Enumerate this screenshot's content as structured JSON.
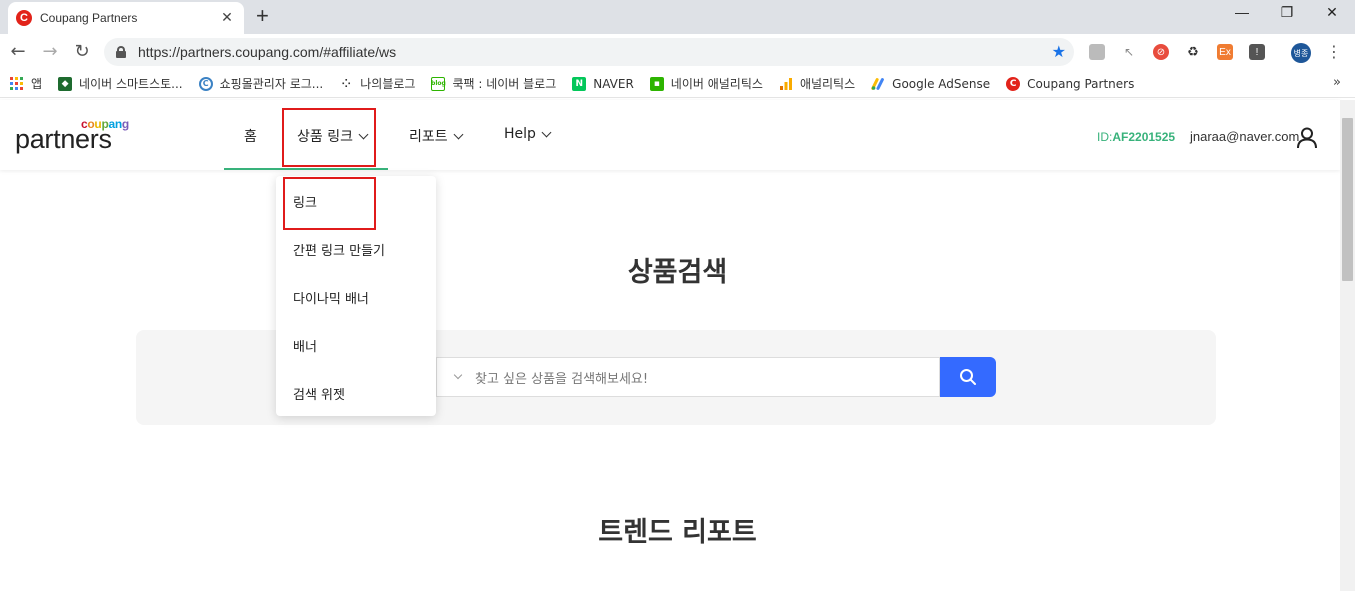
{
  "browser": {
    "tab_title": "Coupang Partners",
    "tab_favicon": "C",
    "tab_close": "✕",
    "new_tab": "+",
    "window_controls": [
      "—",
      "❐",
      "✕"
    ],
    "url": "https://partners.coupang.com/#affiliate/ws",
    "profile_badge": "병종",
    "bookmarks": [
      {
        "label": "앱",
        "icon": "apps-grid-icon"
      },
      {
        "label": "네이버 스마트스토...",
        "icon": "smartstore-icon",
        "color": "#1e6b2f"
      },
      {
        "label": "쇼핑몰관리자 로그...",
        "icon": "cafe24-icon",
        "color": "#3b82c4"
      },
      {
        "label": "나의블로그",
        "icon": "blog-icon",
        "color": "#333333"
      },
      {
        "label": "쿡팩 : 네이버 블로그",
        "icon": "naver-blog-icon",
        "color": "#2db400"
      },
      {
        "label": "NAVER",
        "icon": "naver-icon",
        "color": "#03c75a"
      },
      {
        "label": "네이버 애널리틱스",
        "icon": "naver-analytics-icon",
        "color": "#2db400"
      },
      {
        "label": "애널리틱스",
        "icon": "google-analytics-icon",
        "color": "#f9ab00"
      },
      {
        "label": "Google AdSense",
        "icon": "adsense-icon",
        "color": "#4285f4"
      },
      {
        "label": "Coupang Partners",
        "icon": "coupang-icon",
        "color": "#e2231a"
      }
    ],
    "bookmarks_more": "»"
  },
  "header": {
    "logo_small": "coupang",
    "logo_main": "partners",
    "nav": {
      "home": "홈",
      "product_link": "상품 링크",
      "report": "리포트",
      "help": "Help"
    },
    "id_prefix": "ID:",
    "id_value": "AF2201525",
    "email": "jnaraa@naver.com"
  },
  "dropdown": {
    "items": [
      "링크",
      "간편 링크 만들기",
      "다이나믹 배너",
      "배너",
      "검색 위젯"
    ]
  },
  "main": {
    "search_title": "상품검색",
    "search_placeholder": "찾고 싶은 상품을 검색해보세요!",
    "trend_title": "트렌드 리포트"
  },
  "colors": {
    "accent_green": "#38b27b",
    "search_blue": "#346aff",
    "highlight_red": "#e01b1b"
  }
}
